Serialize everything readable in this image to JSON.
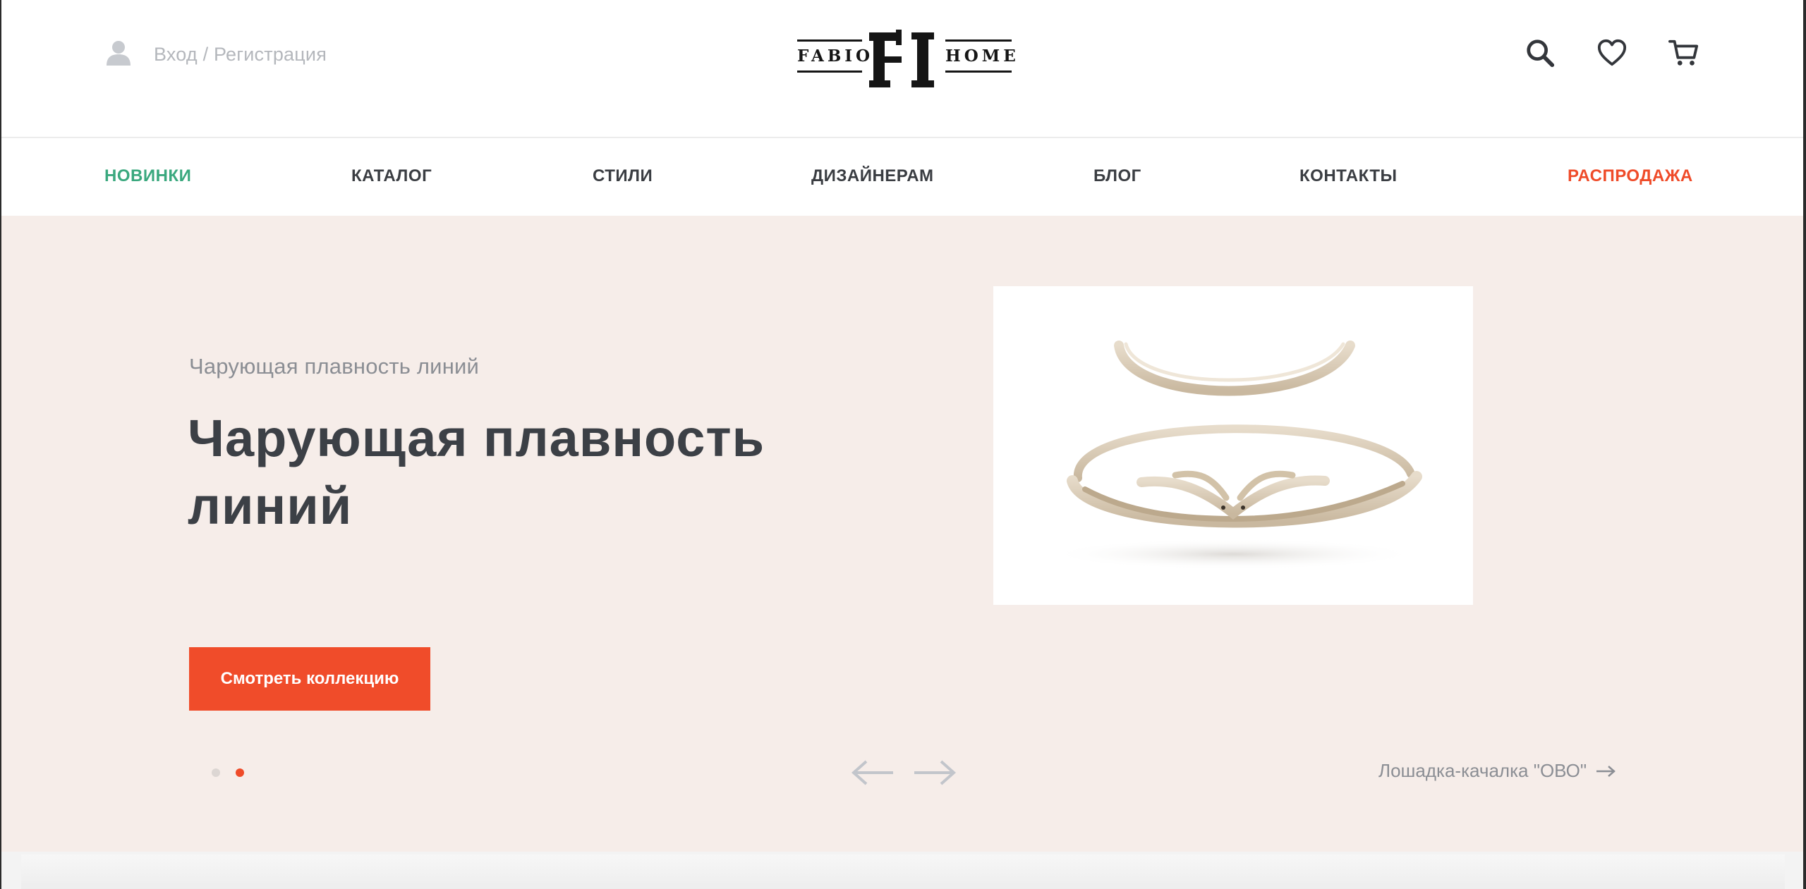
{
  "header": {
    "login_text": "Вход / Регистрация",
    "logo": {
      "left_word": "FABIO",
      "monogram": "FH",
      "right_word": "HOME"
    },
    "icons": [
      "search-icon",
      "heart-icon",
      "cart-icon"
    ]
  },
  "nav": {
    "items": [
      {
        "label": "НОВИНКИ",
        "color": "#3aa87e"
      },
      {
        "label": "КАТАЛОГ"
      },
      {
        "label": "СТИЛИ"
      },
      {
        "label": "ДИЗАЙНЕРАМ"
      },
      {
        "label": "БЛОГ"
      },
      {
        "label": "КОНТАКТЫ"
      },
      {
        "label": "РАСПРОДАЖА",
        "color": "#ef4b29"
      }
    ]
  },
  "hero": {
    "subtitle": "Чарующая плавность линий",
    "title": "Чарующая плавность линий",
    "button_label": "Смотреть коллекцию",
    "product_link": "Лошадка-качалка \"ОВО\"",
    "slides_total": 2,
    "active_slide": 2,
    "background": "#f6ede9",
    "accent": "#f04c2a"
  }
}
